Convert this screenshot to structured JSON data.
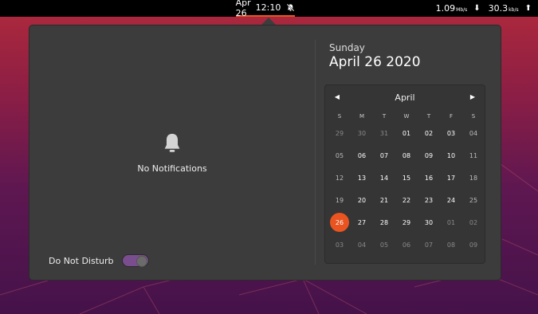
{
  "topbar": {
    "date": "Apr 26",
    "time": "12:10",
    "download_speed": "1.09",
    "download_unit": "Mb/s",
    "upload_speed": "30.3",
    "upload_unit": "kb/s"
  },
  "notifications": {
    "empty_label": "No Notifications",
    "dnd_label": "Do Not Disturb",
    "dnd_on": true
  },
  "date_header": {
    "weekday": "Sunday",
    "full_date": "April 26 2020"
  },
  "calendar": {
    "month": "April",
    "weekday_headers": [
      "S",
      "M",
      "T",
      "W",
      "T",
      "F",
      "S"
    ],
    "weeks": [
      [
        "29",
        "30",
        "31",
        "01",
        "02",
        "03",
        "04"
      ],
      [
        "05",
        "06",
        "07",
        "08",
        "09",
        "10",
        "11"
      ],
      [
        "12",
        "13",
        "14",
        "15",
        "16",
        "17",
        "18"
      ],
      [
        "19",
        "20",
        "21",
        "22",
        "23",
        "24",
        "25"
      ],
      [
        "26",
        "27",
        "28",
        "29",
        "30",
        "01",
        "02"
      ],
      [
        "03",
        "04",
        "05",
        "06",
        "07",
        "08",
        "09"
      ]
    ],
    "out_of_month": [
      [
        0,
        0
      ],
      [
        0,
        1
      ],
      [
        0,
        2
      ],
      [
        4,
        5
      ],
      [
        4,
        6
      ],
      [
        5,
        0
      ],
      [
        5,
        1
      ],
      [
        5,
        2
      ],
      [
        5,
        3
      ],
      [
        5,
        4
      ],
      [
        5,
        5
      ],
      [
        5,
        6
      ]
    ],
    "today": [
      4,
      0
    ]
  },
  "colors": {
    "accent": "#e95420",
    "toggle": "#7a4d8e"
  }
}
